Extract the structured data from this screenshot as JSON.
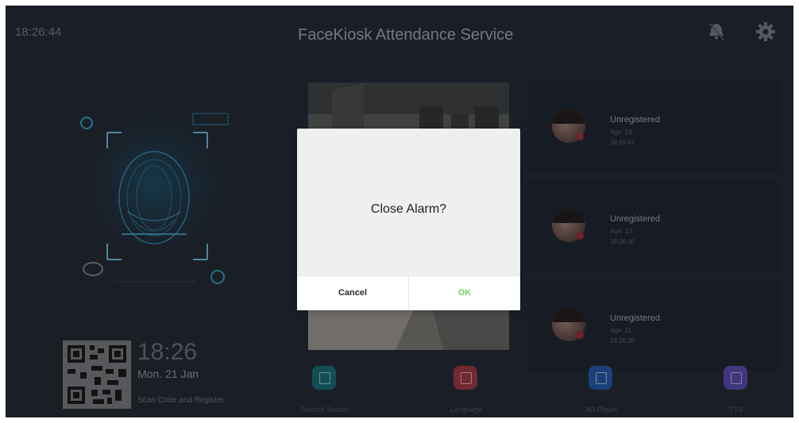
{
  "header": {
    "clock": "18:26:44",
    "title": "FaceKiosk Attendance Service",
    "icons": [
      "alarm-off-icon",
      "gear-icon"
    ]
  },
  "face_panel": {
    "icon": "face-scan-icon"
  },
  "qr_panel": {
    "time": "18:26",
    "date": "Mon. 21 Jan",
    "caption": "Scan Code and Register"
  },
  "records": [
    {
      "name": "Unregistered",
      "age": "Age: 23",
      "time": "18:26:41"
    },
    {
      "name": "Unregistered",
      "age": "Age: 23",
      "time": "18:26:40"
    },
    {
      "name": "Unregistered",
      "age": "Age: 21",
      "time": "18:26:38"
    }
  ],
  "dock": [
    {
      "label": "Record Search",
      "color": "#1f7f89",
      "icon": "record-search-icon"
    },
    {
      "label": "Language",
      "color": "#b9434f",
      "icon": "language-icon"
    },
    {
      "label": "AD Player",
      "color": "#2d69c6",
      "icon": "ad-player-icon"
    },
    {
      "label": "TTS",
      "color": "#6a58c8",
      "icon": "tts-microphone-icon"
    }
  ],
  "dialog": {
    "message": "Close Alarm?",
    "cancel_label": "Cancel",
    "ok_label": "OK",
    "ok_color": "#7bd05a"
  }
}
